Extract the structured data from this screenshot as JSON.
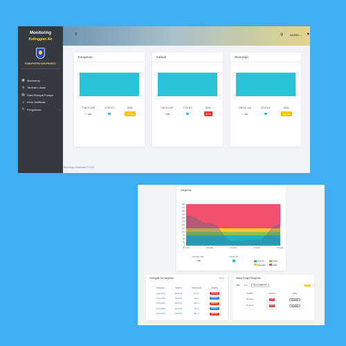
{
  "window1": {
    "brand": {
      "title": "Monitoring",
      "subtitle": "Ketinggian Air",
      "logo_caption": "KABUPATEN SUKOHARJO"
    },
    "nav": [
      {
        "icon": "chart-icon",
        "glyph": "▦",
        "label": "Monitoring"
      },
      {
        "icon": "map-pin-icon",
        "glyph": "⚲",
        "label": "Tambah Lokasi"
      },
      {
        "icon": "file-icon",
        "glyph": "▤",
        "label": "Data Riwayat Pompa"
      },
      {
        "icon": "bell-icon",
        "glyph": "♫",
        "label": "Kirim Notifikasi"
      },
      {
        "icon": "wrench-icon",
        "glyph": "✎",
        "label": "Pengaturan",
        "caret": "‹"
      }
    ],
    "topbar": {
      "menu_glyph": "≡",
      "search_glyph": "⚲",
      "user": "ADMIN",
      "user_caret": "⌄",
      "flag_glyph": "⚑",
      "notif_count": "3"
    },
    "stat_labels": {
      "level": "TINGGI AIR",
      "status": "STATUS",
      "bbm": "BBM"
    },
    "cards": [
      {
        "name": "Kangenan",
        "level": "~ cm",
        "bbm": "37 %",
        "bbm_color": "yellow"
      },
      {
        "name": "Kaliwiri",
        "level": "~ cm",
        "bbm": "0 %",
        "bbm_color": "red"
      },
      {
        "name": "Wonosajo",
        "level": "~ cm",
        "bbm": "37 %",
        "bbm_color": "yellow"
      }
    ],
    "footer": "Sukoharjo Surakarta © 2020"
  },
  "window2": {
    "chart_card_title": "Kangenan",
    "chart_data": {
      "type": "area",
      "x": [
        "06.00.01",
        "06.30.00",
        "07.00.01",
        "07.30.00",
        "08.00.00"
      ],
      "ylim": [
        0,
        300
      ],
      "yticks": [
        0,
        25,
        50,
        75,
        100,
        125,
        150,
        175,
        200,
        225,
        250,
        275,
        300
      ],
      "bands": [
        {
          "name": "Normal",
          "from": 0,
          "to": 75,
          "color": "#1ab3c6"
        },
        {
          "name": "Siaga",
          "from": 75,
          "to": 100,
          "color": "#8bc34a"
        },
        {
          "name": "Waspada",
          "from": 100,
          "to": 125,
          "color": "#ffca28"
        },
        {
          "name": "Awas",
          "from": 125,
          "to": 300,
          "color": "#f0506e"
        }
      ],
      "series": [
        {
          "values": [
            215,
            160,
            30,
            40,
            150
          ],
          "color": "#4a6b8a"
        }
      ]
    },
    "chart_stats": {
      "level": "~ cm",
      "level_label": "TINGGI AIR",
      "status_label": "STATUS"
    },
    "level_table": {
      "title": "Ketinggian Air Kangenan",
      "more": "Detail",
      "headers": [
        "TANGGAL",
        "WAKTU",
        "TINGGI AIR",
        "STATUS"
      ],
      "rows": [
        {
          "date": "11-02-2020",
          "time": "06.00.01",
          "level": "247 cm",
          "status": "BAHAYA",
          "tag": "red"
        },
        {
          "date": "11-02-2020",
          "time": "06.00.07",
          "level": "40 cm",
          "status": "NORMAL",
          "tag": "blue"
        },
        {
          "date": "11-02-2020",
          "time": "06.00.07",
          "level": "180 cm",
          "status": "BAHAYA",
          "tag": "red"
        },
        {
          "date": "11-02-2020",
          "time": "06.00.07",
          "level": "10 cm",
          "status": "NORMAL",
          "tag": "blue"
        },
        {
          "date": "11-02-2020",
          "time": "06.00.07",
          "level": "180 cm",
          "status": "BAHAYA",
          "tag": "red"
        }
      ]
    },
    "pump_table": {
      "title": "Status Pompa Kangenan",
      "filter_label": "BBM",
      "filter_value": "ALL",
      "filter_select": "Semua BBM (%)",
      "warn": "37 %",
      "headers": [
        "POMPA",
        "STATUS",
        "AKSI"
      ],
      "rows": [
        {
          "pump": "Pompa 1",
          "status": "OFF",
          "action": "Nyalakan"
        },
        {
          "pump": "Pompa 2",
          "status": "OFF",
          "action": "Nyalakan"
        }
      ]
    }
  }
}
